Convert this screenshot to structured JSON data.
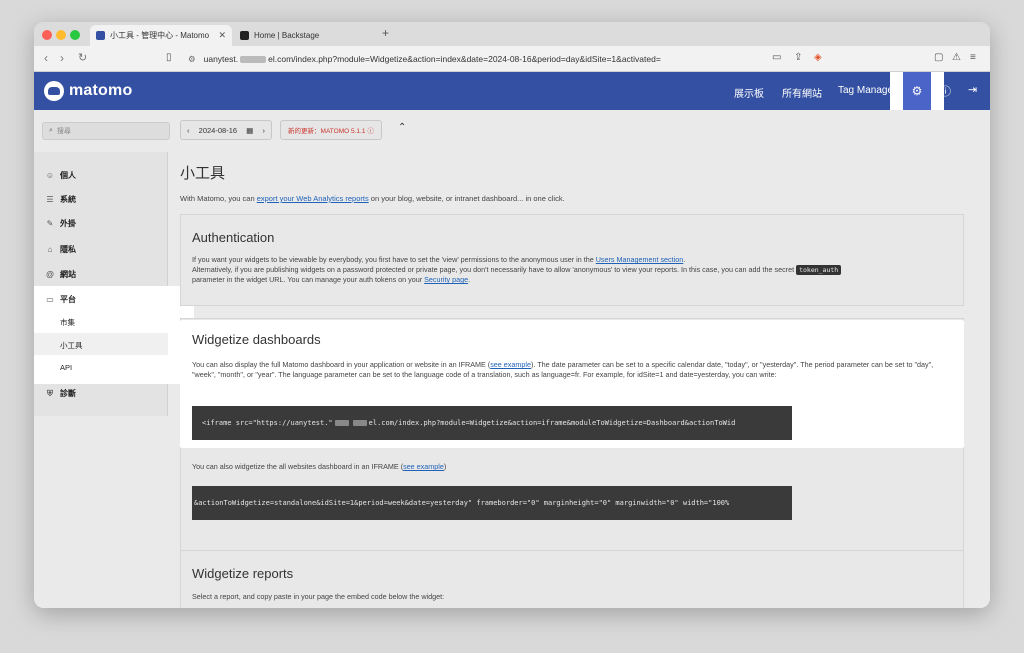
{
  "browser": {
    "tabs": [
      {
        "title": "小工具 - 管理中心 - Matomo"
      },
      {
        "title": "Home |  Backstage"
      }
    ],
    "new_tab": "+",
    "url_prefix": "uanytest.",
    "url_suffix": "el.com/index.php?module=Widgetize&action=index&date=2024-08-16&period=day&idSite=1&activated="
  },
  "header": {
    "logo": "matomo",
    "nav": [
      "展示板",
      "所有網站",
      "Tag Manager"
    ],
    "accent": "#3450a3"
  },
  "toolbar": {
    "search_placeholder": "搜尋",
    "date": "2024-08-16",
    "update": "新的更新：MATOMO 5.1.1"
  },
  "sidebar": {
    "items": [
      {
        "label": "個人",
        "icon": "user-icon"
      },
      {
        "label": "系統",
        "icon": "server-icon"
      },
      {
        "label": "外掛",
        "icon": "plug-icon"
      },
      {
        "label": "隱私",
        "icon": "lock-icon"
      },
      {
        "label": "網站",
        "icon": "at-icon"
      },
      {
        "label": "平台",
        "icon": "monitor-icon"
      },
      {
        "label": "診斷",
        "icon": "shield-icon"
      }
    ],
    "sub_items": [
      "市集",
      "小工具",
      "API"
    ]
  },
  "main": {
    "title": "小工具",
    "intro_pre": "With Matomo, you can ",
    "intro_link": "export your Web Analytics reports",
    "intro_post": " on your blog, website, or intranet dashboard... in one click.",
    "auth": {
      "title": "Authentication",
      "line1_pre": "If you want your widgets to be viewable by everybody, you first have to set the 'view' permissions to the anonymous user in the ",
      "line1_link": "Users Management section",
      "line1_post": ".",
      "line2_pre": "Alternatively, if you are publishing widgets on a password protected or private page, you don't necessarily have to allow 'anonymous' to view your reports. In this case, you can add the secret ",
      "token": "token_auth",
      "line3_pre": "parameter in the widget URL. You can manage your auth tokens on your ",
      "line3_link": "Security page",
      "line3_post": "."
    },
    "widgetize": {
      "title": "Widgetize dashboards",
      "text_pre": "You can also display the full Matomo dashboard in your application or website in an IFRAME (",
      "text_link": "see example",
      "text_post": "). The date parameter can be set to a specific calendar date, \"today\", or \"yesterday\". The period parameter can be set to \"day\", \"week\", \"month\", or \"year\". The language parameter can be set to the language code of a translation, such as language=fr. For example, for idSite=1 and date=yesterday, you can write:",
      "code1_pre": "<iframe src=\"https://uanytest.\"",
      "code1_post": "el.com/index.php?module=Widgetize&action=iframe&moduleToWidgetize=Dashboard&actionToWid",
      "text2_pre": "You can also widgetize the all websites dashboard in an IFRAME (",
      "text2_link": "see example",
      "text2_post": ")",
      "code2": "&actionToWidgetize=standalone&idSite=1&period=week&date=yesterday\" frameborder=\"0\" marginheight=\"0\" marginwidth=\"0\" width=\"100%"
    },
    "reports": {
      "title": "Widgetize reports",
      "text": "Select a report, and copy paste in your page the embed code below the widget:"
    }
  }
}
